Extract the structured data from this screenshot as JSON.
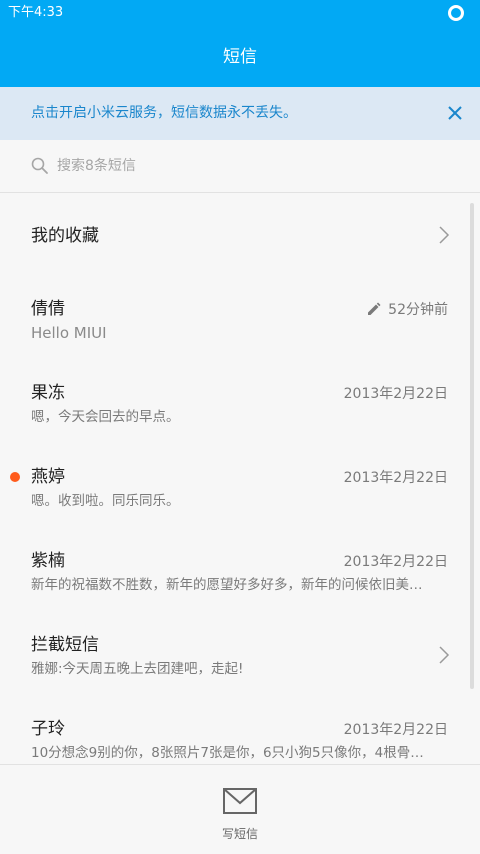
{
  "status_bar": {
    "time": "下午4:33"
  },
  "header": {
    "title": "短信"
  },
  "banner": {
    "text": "点击开启小米云服务，短信数据永不丢失。"
  },
  "search": {
    "placeholder": "搜索8条短信"
  },
  "conversations": [
    {
      "title": "我的收藏",
      "subtitle": "",
      "date": "",
      "kind": "folder"
    },
    {
      "title": "倩倩",
      "subtitle": "Hello MIUI",
      "date": "52分钟前",
      "kind": "draft"
    },
    {
      "title": "果冻",
      "subtitle": "嗯，今天会回去的早点。",
      "date": "2013年2月22日",
      "kind": "normal"
    },
    {
      "title": "燕婷",
      "subtitle": "嗯。收到啦。同乐同乐。",
      "date": "2013年2月22日",
      "kind": "unread"
    },
    {
      "title": "紫楠",
      "subtitle": "新年的祝福数不胜数，新年的愿望好多好多，新年的问候依旧美…",
      "date": "2013年2月22日",
      "kind": "normal"
    },
    {
      "title": "拦截短信",
      "subtitle": "雅娜:今天周五晚上去团建吧，走起!",
      "date": "",
      "kind": "folder"
    },
    {
      "title": "子玲",
      "subtitle": "10分想念9别的你，8张照片7张是你，6只小狗5只像你，4根骨…",
      "date": "2013年2月22日",
      "kind": "normal"
    }
  ],
  "bottom_bar": {
    "compose_label": "写短信"
  },
  "colors": {
    "accent": "#02a9f4",
    "banner_bg": "#dce8f4",
    "banner_text": "#1a86cc",
    "unread_dot": "#ff5b1c"
  },
  "icons": {
    "status": "status-ring-icon",
    "close": "close-icon",
    "search": "search-icon",
    "chevron": "chevron-right-icon",
    "draft": "pencil-icon",
    "compose": "envelope-icon"
  }
}
